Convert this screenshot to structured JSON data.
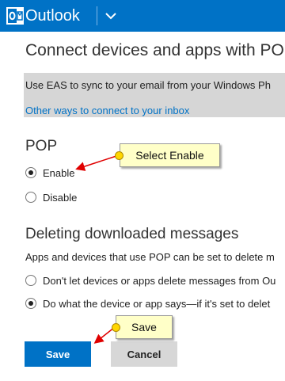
{
  "header": {
    "app_name": "Outlook",
    "bar_color": "#0072c6",
    "logo_icon": "outlook-logo-icon",
    "menu_icon": "chevron-down-icon"
  },
  "page": {
    "title": "Connect devices and apps with POP",
    "eas_notice": "Use EAS to sync to your email from your Windows Ph",
    "other_ways_link": "Other ways to connect to your inbox"
  },
  "pop": {
    "title": "POP",
    "options": [
      {
        "label": "Enable",
        "selected": true
      },
      {
        "label": "Disable",
        "selected": false
      }
    ]
  },
  "deleting": {
    "title": "Deleting downloaded messages",
    "description": "Apps and devices that use POP can be set to delete m",
    "options": [
      {
        "label": "Don't let devices or apps delete messages from Ou",
        "selected": false
      },
      {
        "label": "Do what the device or app says—if it's set to delet",
        "selected": true
      }
    ]
  },
  "buttons": {
    "save": "Save",
    "cancel": "Cancel"
  },
  "annotations": {
    "enable_callout": "Select Enable",
    "save_callout": "Save",
    "arrow_color": "#e00000",
    "callout_color": "#ffffc8"
  }
}
